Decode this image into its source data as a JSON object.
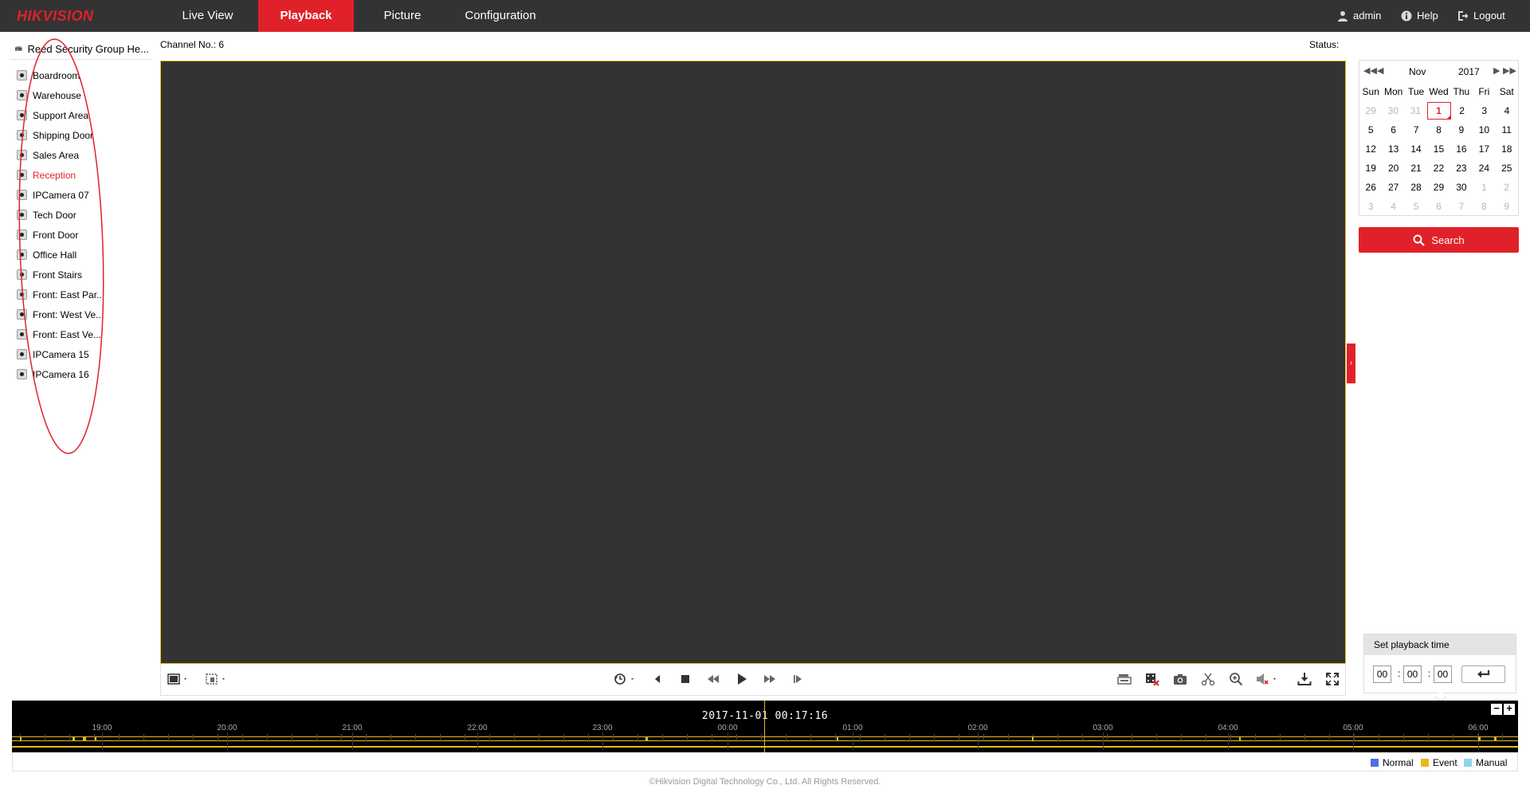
{
  "app": {
    "brand": "HIKVISION",
    "nav_tabs": [
      {
        "label": "Live View"
      },
      {
        "label": "Playback"
      },
      {
        "label": "Picture"
      },
      {
        "label": "Configuration"
      }
    ],
    "user": "admin",
    "help": "Help",
    "logout": "Logout",
    "accent_color": "#e0212a"
  },
  "tree": {
    "root_label": "Reed Security Group He...",
    "cameras": [
      {
        "label": "Boardroom"
      },
      {
        "label": "Warehouse"
      },
      {
        "label": "Support Area"
      },
      {
        "label": "Shipping Door"
      },
      {
        "label": "Sales Area"
      },
      {
        "label": "Reception",
        "selected": true
      },
      {
        "label": "IPCamera 07"
      },
      {
        "label": "Tech Door"
      },
      {
        "label": "Front Door"
      },
      {
        "label": "Office Hall"
      },
      {
        "label": "Front Stairs"
      },
      {
        "label": "Front: East Par..."
      },
      {
        "label": "Front: West Ve..."
      },
      {
        "label": "Front: East Ve..."
      },
      {
        "label": "IPCamera 15"
      },
      {
        "label": "IPCamera 16"
      }
    ]
  },
  "player": {
    "channel_label": "Channel No.: 6",
    "status_label": "Status:"
  },
  "calendar": {
    "month": "Nov",
    "year": "2017",
    "weekdays": [
      "Sun",
      "Mon",
      "Tue",
      "Wed",
      "Thu",
      "Fri",
      "Sat"
    ],
    "weeks": [
      [
        {
          "d": "29",
          "o": true
        },
        {
          "d": "30",
          "o": true
        },
        {
          "d": "31",
          "o": true
        },
        {
          "d": "1",
          "today": true
        },
        {
          "d": "2"
        },
        {
          "d": "3"
        },
        {
          "d": "4"
        }
      ],
      [
        {
          "d": "5"
        },
        {
          "d": "6"
        },
        {
          "d": "7"
        },
        {
          "d": "8"
        },
        {
          "d": "9"
        },
        {
          "d": "10"
        },
        {
          "d": "11"
        }
      ],
      [
        {
          "d": "12"
        },
        {
          "d": "13"
        },
        {
          "d": "14"
        },
        {
          "d": "15"
        },
        {
          "d": "16"
        },
        {
          "d": "17"
        },
        {
          "d": "18"
        }
      ],
      [
        {
          "d": "19"
        },
        {
          "d": "20"
        },
        {
          "d": "21"
        },
        {
          "d": "22"
        },
        {
          "d": "23"
        },
        {
          "d": "24"
        },
        {
          "d": "25"
        }
      ],
      [
        {
          "d": "26"
        },
        {
          "d": "27"
        },
        {
          "d": "28"
        },
        {
          "d": "29"
        },
        {
          "d": "30"
        },
        {
          "d": "1",
          "o": true
        },
        {
          "d": "2",
          "o": true
        }
      ],
      [
        {
          "d": "3",
          "o": true
        },
        {
          "d": "4",
          "o": true
        },
        {
          "d": "5",
          "o": true
        },
        {
          "d": "6",
          "o": true
        },
        {
          "d": "7",
          "o": true
        },
        {
          "d": "8",
          "o": true
        },
        {
          "d": "9",
          "o": true
        }
      ]
    ],
    "search_label": "Search"
  },
  "playback_time": {
    "title": "Set playback time",
    "hh": "00",
    "mm": "00",
    "ss": "00"
  },
  "timeline": {
    "datetime": "2017-11-01 00:17:16",
    "hours": [
      "19:00",
      "20:00",
      "21:00",
      "22:00",
      "23:00",
      "00:00",
      "01:00",
      "02:00",
      "03:00",
      "04:00",
      "05:00",
      "06:00"
    ],
    "legend": [
      {
        "label": "Normal",
        "color": "#4a6fe0"
      },
      {
        "label": "Event",
        "color": "#e8b823"
      },
      {
        "label": "Manual",
        "color": "#8fd3e6"
      }
    ]
  },
  "footer": {
    "copyright": "©Hikvision Digital Technology Co., Ltd. All Rights Reserved."
  }
}
